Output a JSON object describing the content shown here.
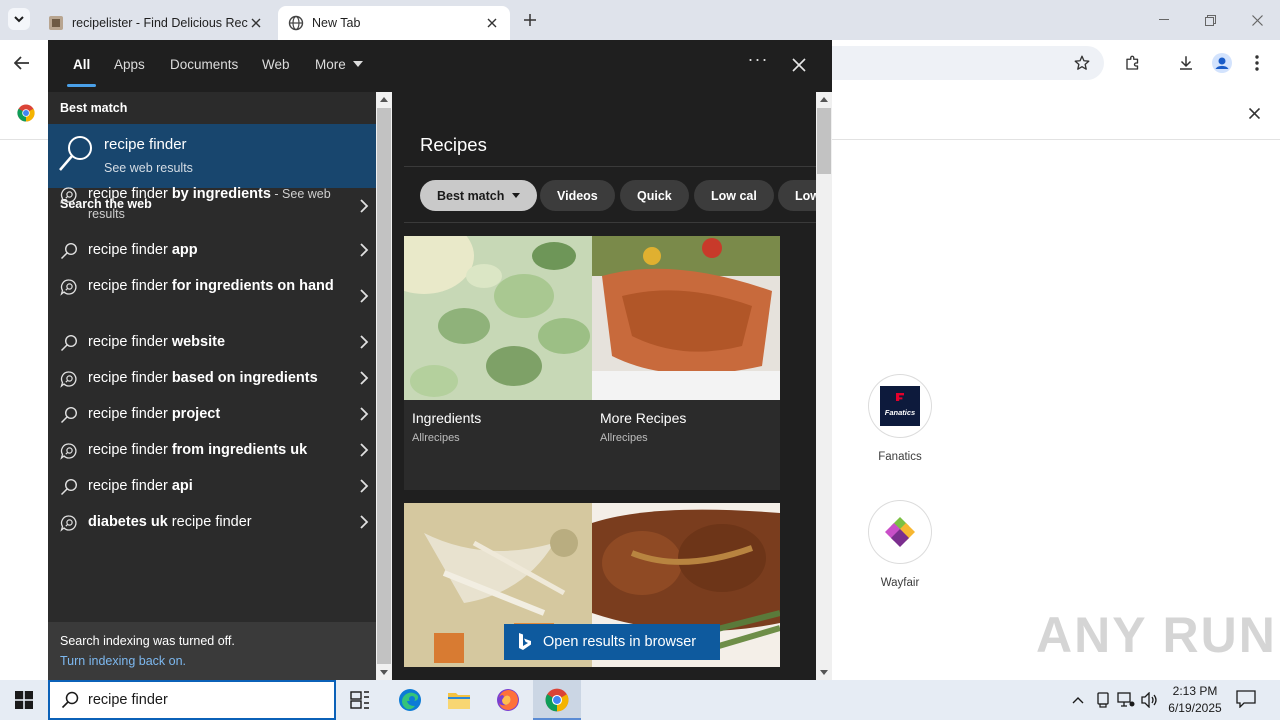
{
  "browser": {
    "tabs": [
      {
        "title": "recipelister - Find Delicious Rec",
        "active": false
      },
      {
        "title": "New Tab",
        "active": true
      }
    ]
  },
  "new_tab": {
    "shortcuts": [
      {
        "label": "Fanatics",
        "logo_text": "Fanatics"
      },
      {
        "label": "Wayfair"
      }
    ],
    "watermark": "ANY RUN"
  },
  "search_panel": {
    "filters": [
      "All",
      "Apps",
      "Documents",
      "Web",
      "More"
    ],
    "active_filter": "All",
    "best_match_header": "Best match",
    "best_match": {
      "title": "recipe finder",
      "subtitle": "See web results"
    },
    "web_header": "Search the web",
    "suggestions": [
      {
        "prefix": "recipe finder ",
        "bold": "by ingredients",
        "suffix": " - See web results",
        "icon": "chat-search-icon"
      },
      {
        "prefix": "recipe finder ",
        "bold": "app",
        "suffix": "",
        "icon": "search-icon"
      },
      {
        "prefix": "recipe finder ",
        "bold": "for ingredients on hand",
        "suffix": "",
        "icon": "chat-search-icon"
      },
      {
        "prefix": "recipe finder ",
        "bold": "website",
        "suffix": "",
        "icon": "search-icon"
      },
      {
        "prefix": "recipe finder ",
        "bold": "based on ingredients",
        "suffix": "",
        "icon": "chat-search-icon"
      },
      {
        "prefix": "recipe finder ",
        "bold": "project",
        "suffix": "",
        "icon": "search-icon"
      },
      {
        "prefix": "recipe finder ",
        "bold": "from ingredients uk",
        "suffix": "",
        "icon": "chat-search-icon"
      },
      {
        "prefix": "recipe finder ",
        "bold": "api",
        "suffix": "",
        "icon": "search-icon"
      },
      {
        "prefix": "",
        "bold": "diabetes uk",
        "suffix": " recipe finder",
        "icon": "chat-search-icon"
      }
    ],
    "indexing_message": "Search indexing was turned off.",
    "indexing_link": "Turn indexing back on.",
    "recipes_title": "Recipes",
    "chips": [
      "Best match",
      "Videos",
      "Quick",
      "Low cal",
      "Low"
    ],
    "cards": [
      {
        "title": "Ingredients",
        "source": "Allrecipes",
        "image": "cucumber-salad"
      },
      {
        "title": "More Recipes",
        "source": "Allrecipes",
        "image": "baked-salmon"
      },
      {
        "image": "chicken-soup"
      },
      {
        "image": "pork-chops"
      }
    ],
    "open_in_browser": "Open results in browser"
  },
  "taskbar": {
    "search_value": "recipe finder",
    "time": "2:13 PM",
    "date": "6/19/2025"
  },
  "colors": {
    "panel_bg": "#1f1f1f",
    "left_pane_bg": "#2b2b2b",
    "best_match_bg": "#18466e",
    "accent_blue": "#0e5a9e",
    "link_blue": "#7db8ef"
  }
}
